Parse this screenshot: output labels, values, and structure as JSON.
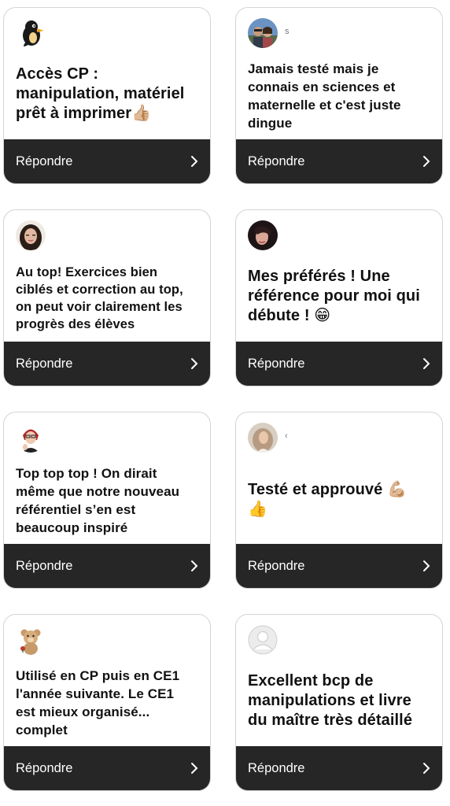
{
  "reply_label": "Répondre",
  "cards": [
    {
      "text": "Accès CP :\nmanipulation, matériel\nprêt à imprimer👍🏼",
      "name": ""
    },
    {
      "text": "Jamais testé mais je\nconnais en sciences et\nmaternelle et c'est juste\ndingue",
      "name": "s"
    },
    {
      "text": "Au top! Exercices bien\nciblés et correction au top,\non peut voir clairement les\nprogrès des élèves",
      "name": ""
    },
    {
      "text": "Mes préférés ! Une\nréférence pour moi qui\ndébute ! 😁",
      "name": ""
    },
    {
      "text": "Top top top ! On dirait\nmême que notre nouveau\nréférentiel s’en est\nbeaucoup inspiré",
      "name": ""
    },
    {
      "text": "Testé et approuvé 💪🏼\n👍",
      "name": "‹"
    },
    {
      "text": "Utilisé en CP puis en CE1\nl'année suivante.  Le CE1\nest mieux organisé...\ncomplet",
      "name": ""
    },
    {
      "text": "Excellent bcp de\nmanipulations et livre\ndu maître très détaillé",
      "name": ""
    }
  ]
}
